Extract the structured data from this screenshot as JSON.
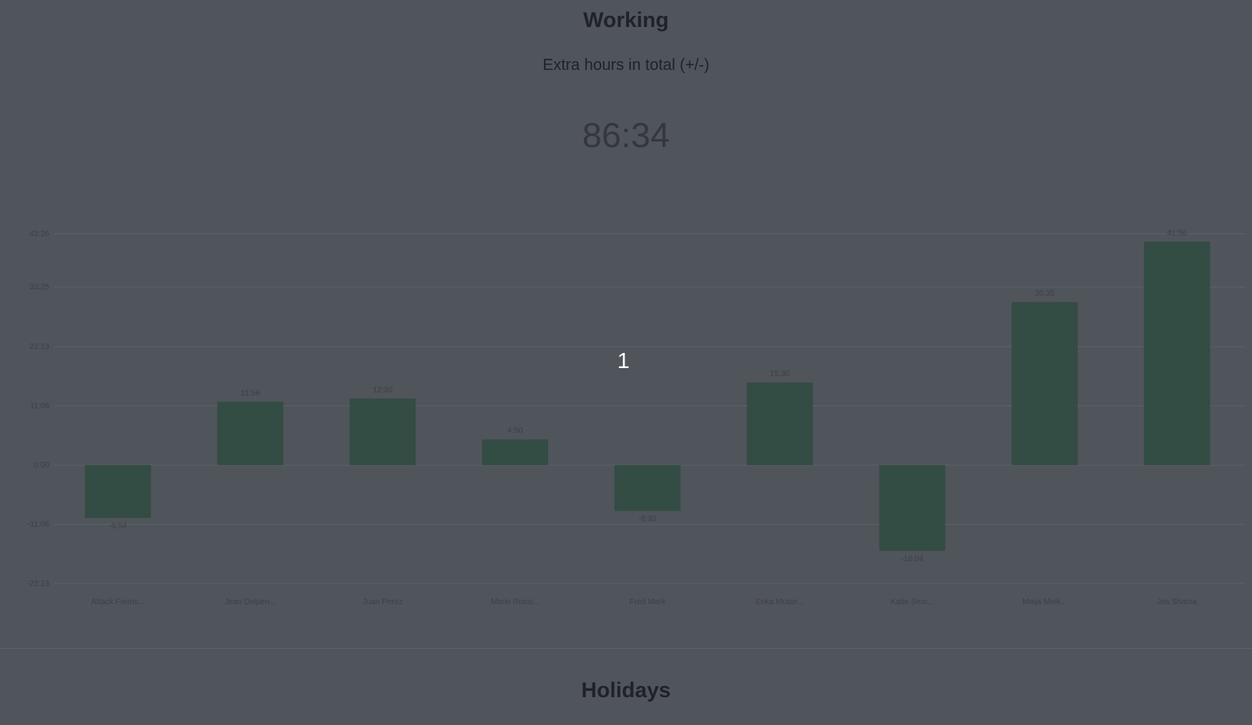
{
  "page": {
    "section_title": "Working",
    "subtitle": "Extra hours in total (+/-)",
    "total": "86:34",
    "overlay_number": "1",
    "next_section_title": "Holidays"
  },
  "colors": {
    "background": "#50545b",
    "bar": "#334c44",
    "grid": "#5d6168"
  },
  "chart_data": {
    "type": "bar",
    "categories": [
      "Attack Forms...",
      "Jean Delpen...",
      "Juan Perez",
      "Mario Rossi...",
      "Fred Mark",
      "Erika Muste...",
      "Katie Smo...",
      "Maija Meik...",
      "Jos Shama"
    ],
    "values": [
      -9.9,
      11.9,
      12.5,
      4.83,
      -8.58,
      15.5,
      -16.07,
      30.58,
      41.93
    ],
    "value_labels": [
      "-9:54",
      "11:56",
      "12:30",
      "4:50",
      "-8:35",
      "15:30",
      "-16:04",
      "30:35",
      "41:56"
    ],
    "yticks": [
      43.43,
      33.42,
      22.22,
      11.1,
      0,
      -11.1,
      -22.22
    ],
    "ytick_labels": [
      "43:26",
      "33:25",
      "22:13",
      "11:06",
      "0:00",
      "-11:06",
      "-22:13"
    ],
    "ylim": [
      -22.22,
      43.43
    ],
    "title": "",
    "xlabel": "",
    "ylabel": "",
    "grid": true,
    "legend": "none"
  }
}
